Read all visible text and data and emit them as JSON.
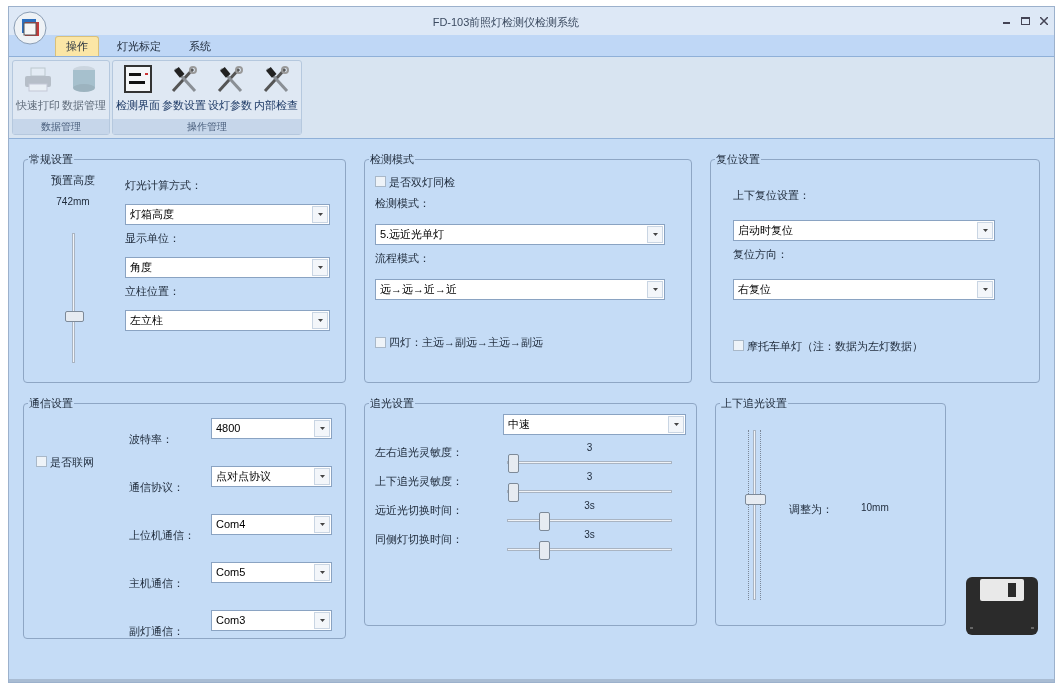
{
  "window": {
    "title": "FD-103前照灯检测仪检测系统"
  },
  "ribbon": {
    "tabs": [
      {
        "label": "操作",
        "selected": true
      },
      {
        "label": "灯光标定",
        "selected": false
      },
      {
        "label": "系统",
        "selected": false
      }
    ],
    "groups": [
      {
        "label": "数据管理",
        "buttons": [
          {
            "label": "快速打印",
            "kind": "printer",
            "disabled": true
          },
          {
            "label": "数据管理",
            "kind": "database",
            "disabled": true
          }
        ]
      },
      {
        "label": "操作管理",
        "buttons": [
          {
            "label": "检测界面",
            "kind": "screen",
            "disabled": false
          },
          {
            "label": "参数设置",
            "kind": "tools",
            "disabled": false
          },
          {
            "label": "设灯参数",
            "kind": "tools",
            "disabled": false
          },
          {
            "label": "内部检查",
            "kind": "tools",
            "disabled": false
          }
        ]
      }
    ]
  },
  "general_settings": {
    "title": "常规设置",
    "preset_height": {
      "label": "预置高度",
      "reading": "742mm",
      "level": 0.35
    },
    "fields": [
      {
        "label": "灯光计算方式：",
        "value": "灯箱高度"
      },
      {
        "label": "显示单位：",
        "value": "角度"
      },
      {
        "label": "立柱位置：",
        "value": "左立柱"
      }
    ]
  },
  "detection_mode": {
    "title": "检测模式",
    "dual_check": {
      "label": "是否双灯同检",
      "checked": false
    },
    "fields": [
      {
        "label": "检测模式：",
        "value": "5.远近光单灯"
      },
      {
        "label": "流程模式：",
        "value": "远→远→近→近"
      }
    ],
    "four_lamp": {
      "label": "四灯：主远→副远→主远→副远",
      "checked": false
    }
  },
  "reset_settings": {
    "title": "复位设置",
    "fields": [
      {
        "label": "上下复位设置：",
        "value": "启动时复位"
      },
      {
        "label": "复位方向：",
        "value": "右复位"
      }
    ],
    "motorcycle": {
      "label": "摩托车单灯（注：数据为左灯数据）",
      "checked": false
    }
  },
  "comm_settings": {
    "title": "通信设置",
    "networked": {
      "label": "是否联网",
      "checked": false
    },
    "fields": [
      {
        "label": "波特率：",
        "value": "4800"
      },
      {
        "label": "通信协议：",
        "value": "点对点协议"
      },
      {
        "label": "上位机通信：",
        "value": "Com4"
      },
      {
        "label": "主机通信：",
        "value": "Com5"
      },
      {
        "label": "副灯通信：",
        "value": "Com3"
      }
    ]
  },
  "tracking_settings": {
    "title": "追光设置",
    "speed": "中速",
    "sliders": [
      {
        "label": "左右追光灵敏度：",
        "reading": "3",
        "level": 0
      },
      {
        "label": "上下追光灵敏度：",
        "reading": "3",
        "level": 0
      },
      {
        "label": "远近光切换时间：",
        "reading": "3s",
        "level": 0.2
      },
      {
        "label": "同侧灯切换时间：",
        "reading": "3s",
        "level": 0.2
      }
    ]
  },
  "vertical_tracking": {
    "title": "上下追光设置",
    "level": 0.6,
    "label": "调整为：",
    "reading": "10mm"
  }
}
